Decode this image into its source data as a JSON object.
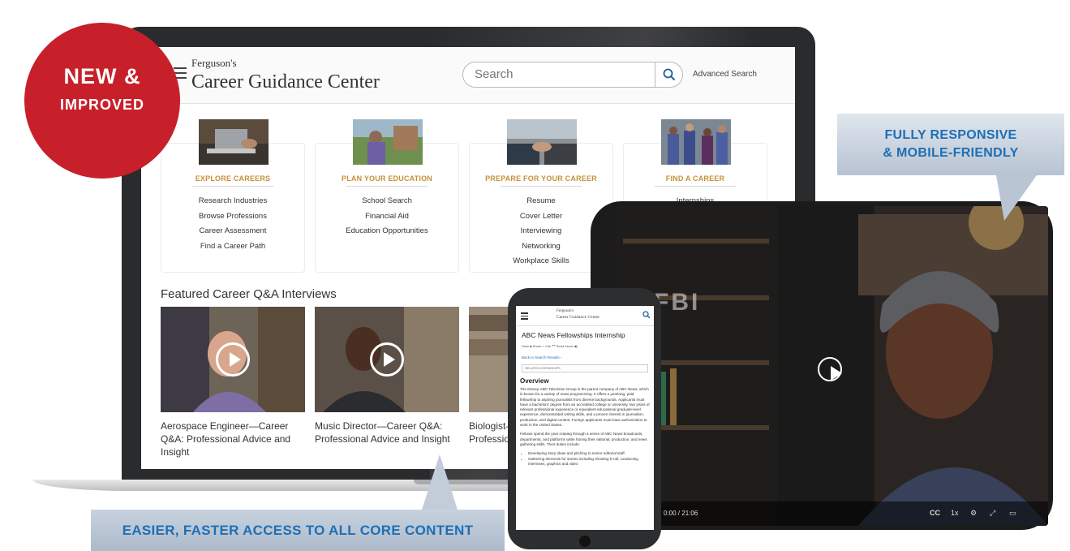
{
  "badge": {
    "line1": "NEW &",
    "line2": "IMPROVED",
    "color": "#c7202b"
  },
  "callouts": {
    "top_line1": "FULLY RESPONSIVE",
    "top_line2": "& MOBILE-FRIENDLY",
    "bottom": "EASIER, FASTER ACCESS TO ALL CORE CONTENT",
    "text_color": "#1e6fb5"
  },
  "header": {
    "brand_small": "Ferguson's",
    "brand_large": "Career Guidance Center",
    "search_placeholder": "Search",
    "advanced_search": "Advanced Search"
  },
  "cards": [
    {
      "title": "EXPLORE CAREERS",
      "links": [
        "Research Industries",
        "Browse Professions",
        "Career Assessment",
        "Find a Career Path"
      ]
    },
    {
      "title": "PLAN YOUR EDUCATION",
      "links": [
        "School Search",
        "Financial Aid",
        "Education Opportunities"
      ]
    },
    {
      "title": "PREPARE FOR YOUR CAREER",
      "links": [
        "Resume",
        "Cover Letter",
        "Interviewing",
        "Networking",
        "Workplace Skills"
      ]
    },
    {
      "title": "FIND A CAREER",
      "links": [
        "Internships"
      ]
    }
  ],
  "featured": {
    "title": "Featured Career Q&A Interviews",
    "videos": [
      {
        "caption": "Aerospace Engineer—Career Q&A: Professional Advice and Insight"
      },
      {
        "caption": "Music Director—Career Q&A: Professional Advice and Insight"
      },
      {
        "caption": "Biologist—Career Q&A: Professional Advice and Insight"
      }
    ]
  },
  "tablet": {
    "time": "0:00 / 21:06",
    "speed": "1x",
    "cc": "CC",
    "wall_text": "FBI"
  },
  "phone": {
    "brand_small": "Ferguson's",
    "brand_large": "Career Guidance Center",
    "title": "ABC News Fellowships Internship",
    "meta": "Save ■   Share <   Cite ❝❞   Read Aloud ◀)",
    "back": "Back to Search Results ›",
    "related": "RELATED INTERNSHIPS",
    "overview": "Overview",
    "para1": "The Disney-ABC Television Group is the parent company of ABC News, which is known for a variety of news programming. It offers a yearlong, paid fellowship to aspiring journalists from diverse backgrounds. Applicants must have a bachelors' degree from an accredited college or university, two years of relevant professional experience or equivalent educational graduate-level experience, demonstrated writing skills, and a proven interest in journalism, production, and digital content. Foreign applicants must have authorization to work in the United States.",
    "para2": "Fellows spend the year rotating through a series of ABC News broadcasts, departments, and platforms while honing their editorial, production, and news gathering skills. Their duties include:",
    "bullet1": "Developing story ideas and pitching to senior editorial staff",
    "bullet2": "Gathering elements for stories including shooting b-roll, conducting interviews, graphics and video"
  }
}
